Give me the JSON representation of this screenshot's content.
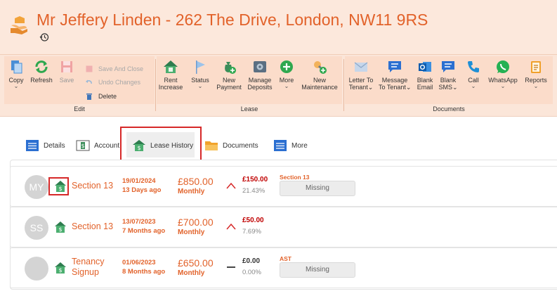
{
  "header": {
    "title": "Mr Jeffery Linden - 262 The Drive, London, NW11 9RS",
    "icon": "handshake-house-icon",
    "history_icon": "history-icon"
  },
  "ribbon": {
    "edit_group": {
      "label": "Edit",
      "copy": "Copy",
      "refresh": "Refresh",
      "save": "Save",
      "save_and_close": "Save And Close",
      "undo_changes": "Undo Changes",
      "delete": "Delete"
    },
    "lease_group": {
      "label": "Lease",
      "rent_increase": [
        "Rent",
        "Increase"
      ],
      "status": "Status",
      "new_payment": [
        "New",
        "Payment"
      ],
      "manage_deposits": [
        "Manage",
        "Deposits"
      ],
      "more": "More",
      "new_maintenance": [
        "New",
        "Maintenance"
      ]
    },
    "documents_group": {
      "label": "Documents",
      "letter_to_tenant": [
        "Letter To",
        "Tenant"
      ],
      "message_to_tenant": [
        "Message",
        "To Tenant"
      ],
      "blank_email": [
        "Blank",
        "Email"
      ],
      "blank_sms": [
        "Blank",
        "SMS"
      ],
      "call": "Call",
      "whatsapp": "WhatsApp",
      "reports": "Reports"
    }
  },
  "tabs": {
    "details": "Details",
    "account": "Account",
    "lease_history": "Lease History",
    "documents": "Documents",
    "more": "More",
    "active": "Lease History"
  },
  "leases": [
    {
      "avatar": "MY",
      "type": "Section 13",
      "date": "19/01/2024",
      "ago": "13 Days ago",
      "rent": "£850.00",
      "period": "Monthly",
      "trend": "up",
      "increase": "£150.00",
      "increase_pct": "21.43%",
      "notice": "Section 13",
      "status": "Missing"
    },
    {
      "avatar": "SS",
      "type": "Section 13",
      "date": "13/07/2023",
      "ago": "7 Months ago",
      "rent": "£700.00",
      "period": "Monthly",
      "trend": "up",
      "increase": "£50.00",
      "increase_pct": "7.69%",
      "notice": "",
      "status": ""
    },
    {
      "avatar": "",
      "type": "Tenancy Signup",
      "type_lines": [
        "Tenancy",
        "Signup"
      ],
      "date": "01/06/2023",
      "ago": "8 Months ago",
      "rent": "£650.00",
      "period": "Monthly",
      "trend": "flat",
      "increase": "£0.00",
      "increase_pct": "0.00%",
      "notice": "AST",
      "status": "Missing"
    }
  ],
  "colors": {
    "accent": "#e2622a",
    "header_bg": "#fce8dc",
    "ribbon_group_bg": "#fbdcca",
    "highlight_box": "#d62828",
    "increase_red": "#c00000"
  }
}
